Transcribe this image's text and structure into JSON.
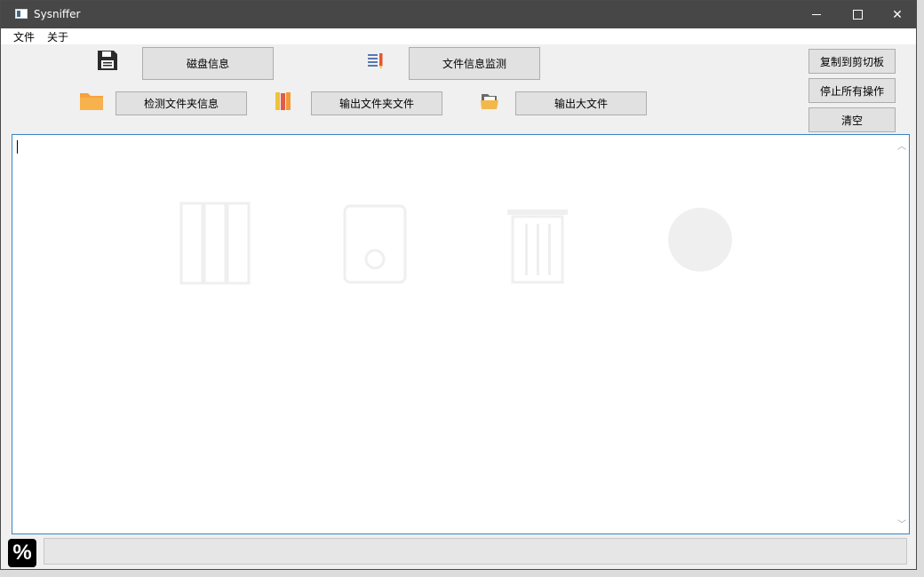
{
  "window": {
    "title": "Sysniffer"
  },
  "menu": {
    "file": "文件",
    "about": "关于"
  },
  "toolbar": {
    "disk_info": "磁盘信息",
    "file_monitor": "文件信息监测",
    "check_folder": "检测文件夹信息",
    "export_folder": "输出文件夹文件",
    "export_large": "输出大文件",
    "copy_clipboard": "复制到剪切板",
    "stop_all": "停止所有操作",
    "clear": "清空"
  },
  "output": {
    "text": ""
  },
  "status": {
    "percent_symbol": "%"
  },
  "icons": {
    "disk": "floppy-disk-icon",
    "monitor": "document-pencil-icon",
    "folder": "folder-icon",
    "books": "books-icon",
    "open_folder": "open-folder-icon"
  }
}
